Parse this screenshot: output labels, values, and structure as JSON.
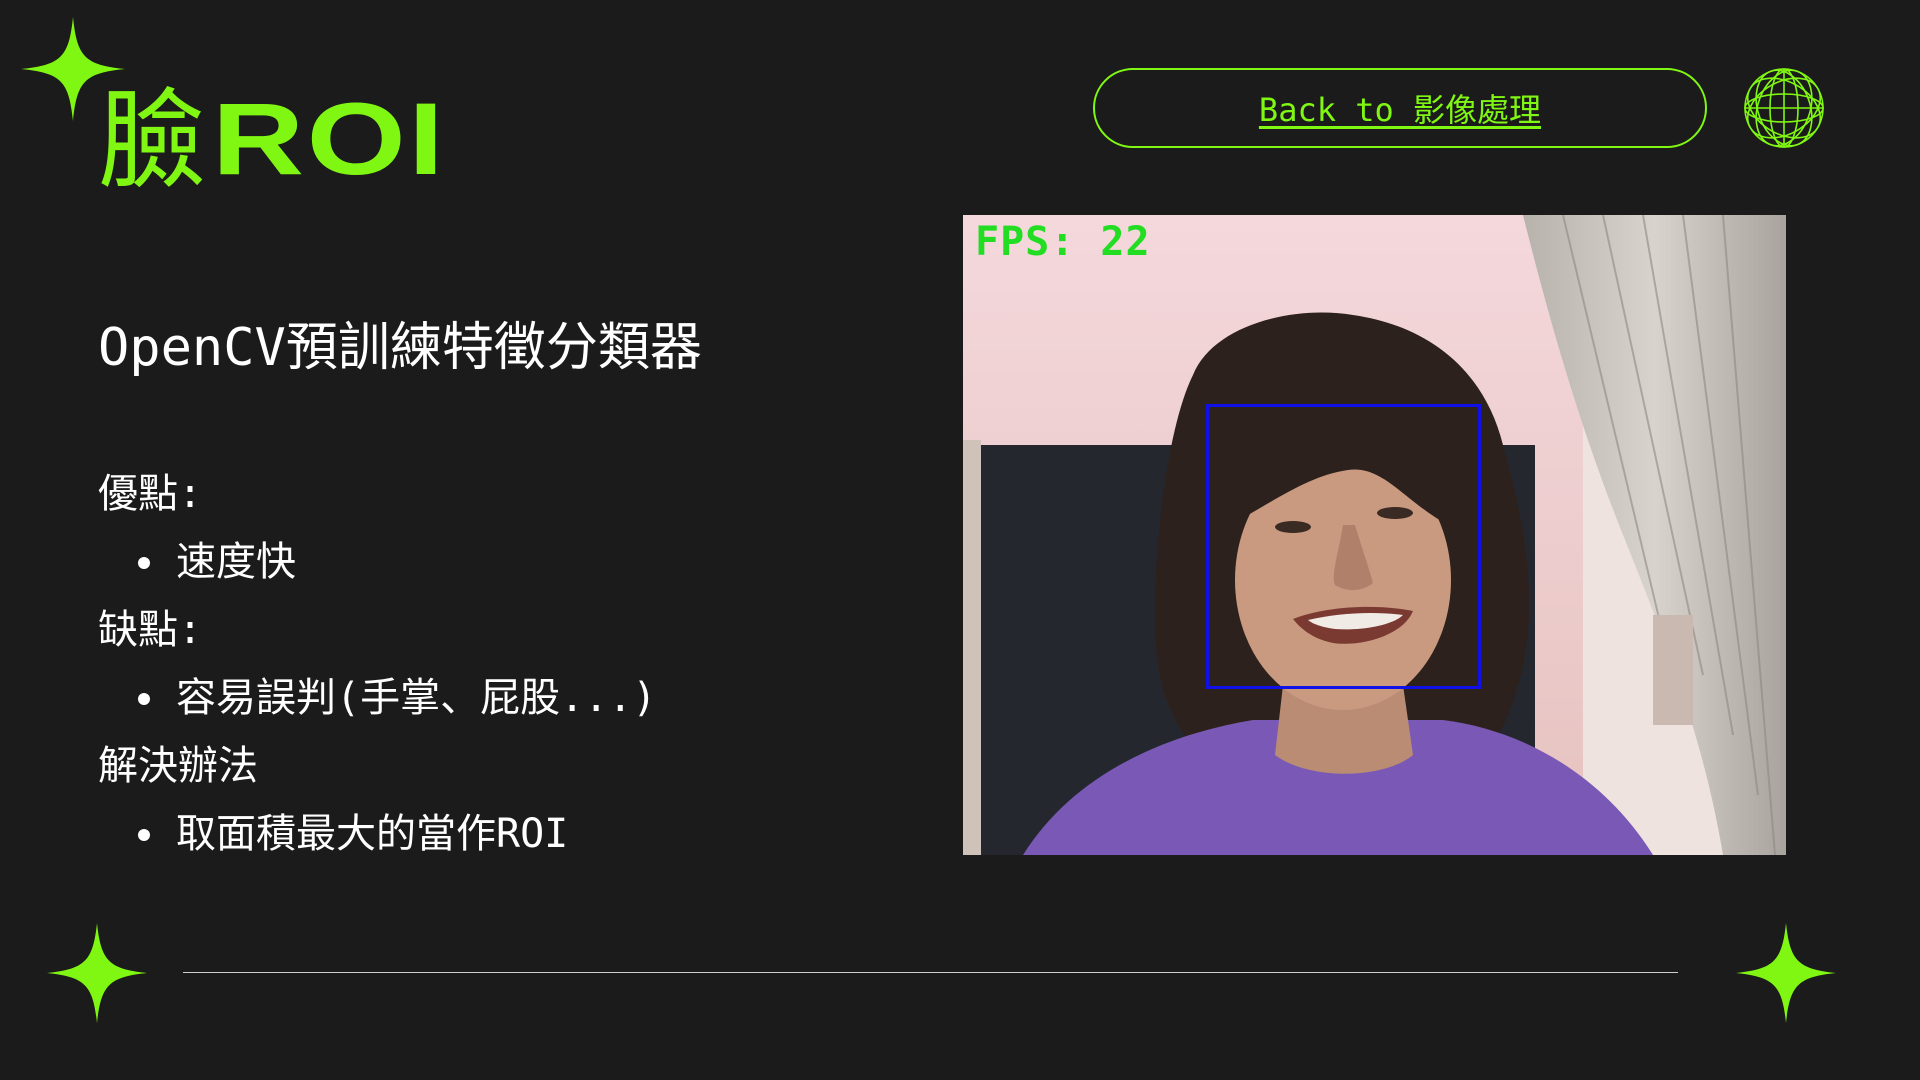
{
  "header": {
    "title_cjk": "臉",
    "title_latin": "ROI",
    "back_button_label": "Back to 影像處理"
  },
  "main": {
    "subtitle": "OpenCV預訓練特徵分類器",
    "sections": [
      {
        "heading": "優點:",
        "bullet": "速度快"
      },
      {
        "heading": "缺點:",
        "bullet": "容易誤判(手掌、屁股...)"
      },
      {
        "heading": "解決辦法",
        "bullet": "取面積最大的當作ROI"
      }
    ]
  },
  "webcam": {
    "fps_text": "FPS: 22",
    "detection_box_color": "#1010e8"
  },
  "colors": {
    "accent": "#80f712",
    "background": "#1b1b1b",
    "text": "#ffffff"
  },
  "icons": {
    "sparkle": "sparkle-icon",
    "globe": "globe-icon"
  }
}
